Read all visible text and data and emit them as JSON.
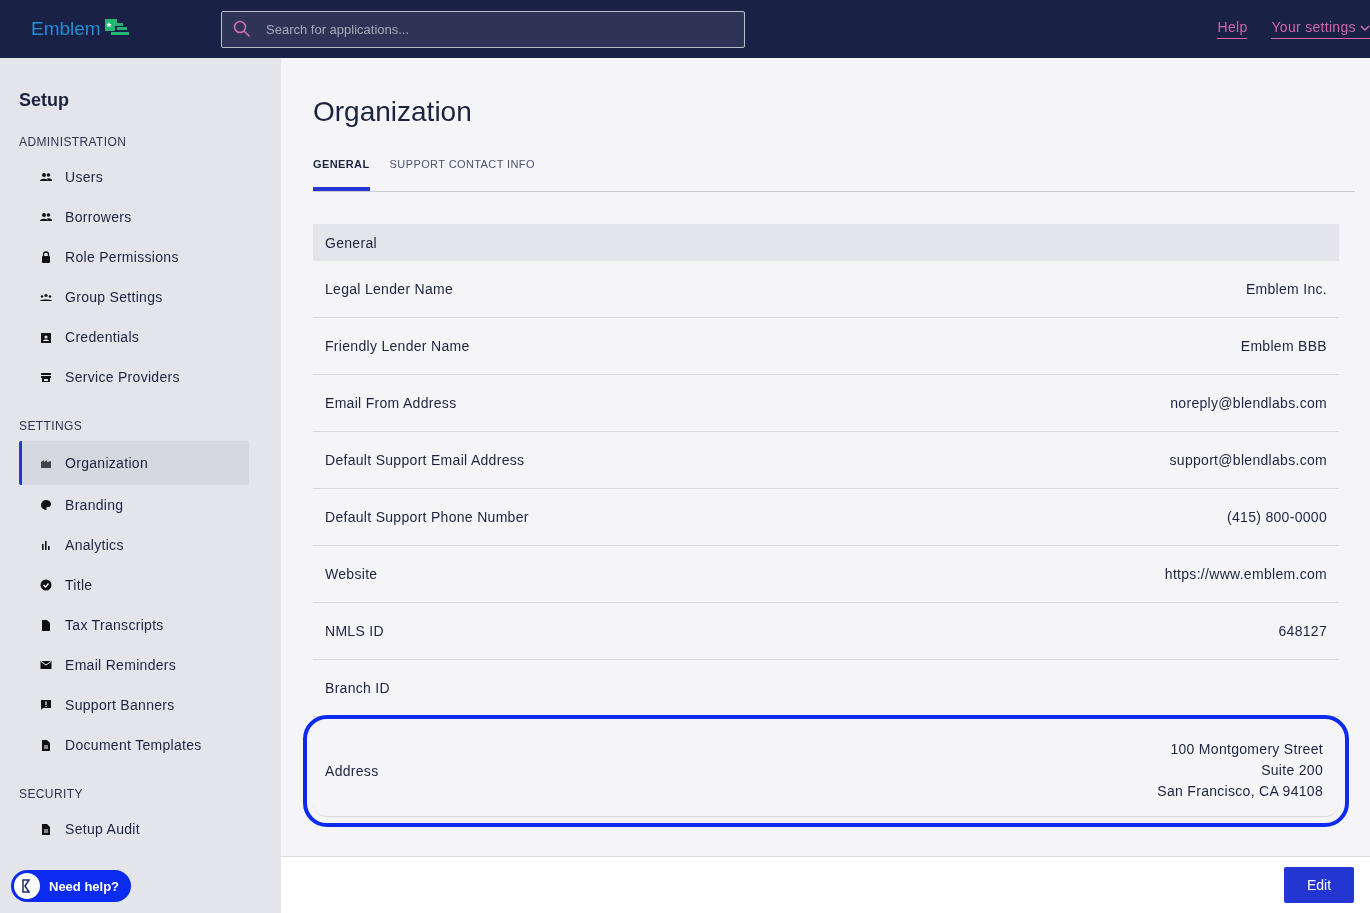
{
  "header": {
    "logo": "Emblem",
    "search": {
      "placeholder": "Search for applications..."
    },
    "links": [
      {
        "label": "Help",
        "kind": "link"
      },
      {
        "label": "Your settings",
        "kind": "menu"
      }
    ]
  },
  "sidebar": {
    "title": "Setup",
    "sections": [
      {
        "heading": "ADMINISTRATION",
        "items": [
          {
            "label": "Users",
            "selected": false
          },
          {
            "label": "Borrowers",
            "selected": false
          },
          {
            "label": "Role Permissions",
            "selected": false
          },
          {
            "label": "Group Settings",
            "selected": false
          },
          {
            "label": "Credentials",
            "selected": false
          },
          {
            "label": "Service Providers",
            "selected": false
          }
        ]
      },
      {
        "heading": "SETTINGS",
        "items": [
          {
            "label": "Organization",
            "selected": true
          },
          {
            "label": "Branding",
            "selected": false
          },
          {
            "label": "Analytics",
            "selected": false
          },
          {
            "label": "Title",
            "selected": false
          },
          {
            "label": "Tax Transcripts",
            "selected": false
          },
          {
            "label": "Email Reminders",
            "selected": false
          },
          {
            "label": "Support Banners",
            "selected": false
          },
          {
            "label": "Document Templates",
            "selected": false
          }
        ]
      },
      {
        "heading": "SECURITY",
        "items": [
          {
            "label": "Setup Audit",
            "selected": false
          }
        ]
      }
    ]
  },
  "help_button": {
    "label": "Need help?"
  },
  "page": {
    "title": "Organization",
    "tabs": [
      {
        "label": "GENERAL",
        "selected": true
      },
      {
        "label": "SUPPORT CONTACT INFO",
        "selected": false
      }
    ],
    "table": {
      "heading": "General",
      "rows": [
        {
          "label": "Legal Lender Name",
          "value": [
            "Emblem Inc."
          ],
          "highlighted": false
        },
        {
          "label": "Friendly Lender Name",
          "value": [
            "Emblem BBB"
          ],
          "highlighted": false
        },
        {
          "label": "Email From Address",
          "value": [
            "noreply@blendlabs.com"
          ],
          "highlighted": false
        },
        {
          "label": "Default Support Email Address",
          "value": [
            "support@blendlabs.com"
          ],
          "highlighted": false
        },
        {
          "label": "Default Support Phone Number",
          "value": [
            "(415) 800-0000"
          ],
          "highlighted": false
        },
        {
          "label": "Website",
          "value": [
            "https://www.emblem.com"
          ],
          "highlighted": false
        },
        {
          "label": "NMLS ID",
          "value": [
            "648127"
          ],
          "highlighted": false
        },
        {
          "label": "Branch ID",
          "value": [],
          "highlighted": false
        },
        {
          "label": "Address",
          "value": [
            "100 Montgomery Street",
            "Suite 200",
            "San Francisco, CA 94108"
          ],
          "highlighted": true
        }
      ]
    },
    "edit_button": "Edit"
  }
}
